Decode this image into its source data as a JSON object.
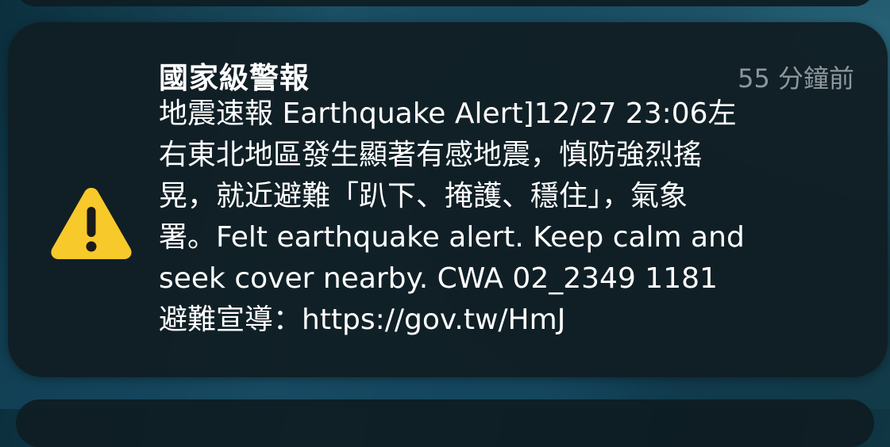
{
  "notification": {
    "app_name": "國家級警報",
    "time_ago": "55 分鐘前",
    "icon": "warning-triangle-icon",
    "icon_color": "#F8C92A",
    "message_lines": [
      "地震速報 Earthquake Alert]12/27 23:06左",
      "右東北地區發生顯著有感地震，慎防強烈搖",
      "晃，就近避難「趴下、掩護、穩住」，氣象",
      "署。Felt earthquake alert. Keep calm and",
      "seek cover nearby. CWA 02_2349 1181",
      "避難宣導：https://gov.tw/HmJ"
    ]
  }
}
